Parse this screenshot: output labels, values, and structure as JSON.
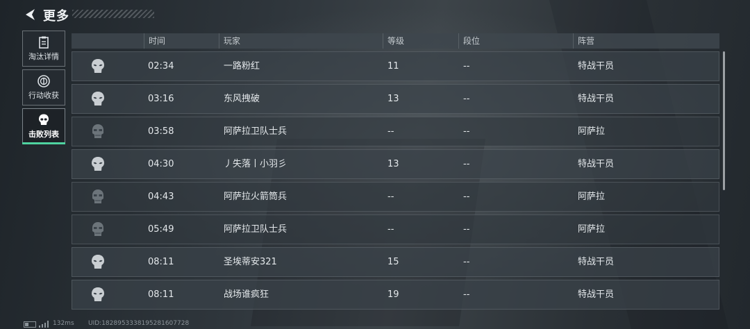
{
  "header": {
    "title": "更多"
  },
  "tabs": [
    {
      "label": "淘汰详情",
      "icon": "clipboard-icon",
      "active": false
    },
    {
      "label": "行动收获",
      "icon": "coin-icon",
      "active": false
    },
    {
      "label": "击败列表",
      "icon": "skull-icon",
      "active": true
    }
  ],
  "table": {
    "columns": {
      "time": "时间",
      "player": "玩家",
      "level": "等级",
      "rank": "段位",
      "faction": "阵营"
    },
    "rows": [
      {
        "time": "02:34",
        "player": "一路粉红",
        "level": "11",
        "rank": "--",
        "faction": "特战干员",
        "type": "operator"
      },
      {
        "time": "03:16",
        "player": "东风拽破",
        "level": "13",
        "rank": "--",
        "faction": "特战干员",
        "type": "operator"
      },
      {
        "time": "03:58",
        "player": "阿萨拉卫队士兵",
        "level": "--",
        "rank": "--",
        "faction": "阿萨拉",
        "type": "ai"
      },
      {
        "time": "04:30",
        "player": "丿失落丨小羽彡",
        "level": "13",
        "rank": "--",
        "faction": "特战干员",
        "type": "operator"
      },
      {
        "time": "04:43",
        "player": "阿萨拉火箭筒兵",
        "level": "--",
        "rank": "--",
        "faction": "阿萨拉",
        "type": "ai"
      },
      {
        "time": "05:49",
        "player": "阿萨拉卫队士兵",
        "level": "--",
        "rank": "--",
        "faction": "阿萨拉",
        "type": "ai"
      },
      {
        "time": "08:11",
        "player": "圣埃蒂安321",
        "level": "15",
        "rank": "--",
        "faction": "特战干员",
        "type": "operator"
      },
      {
        "time": "08:11",
        "player": "战场谁疯狂",
        "level": "19",
        "rank": "--",
        "faction": "特战干员",
        "type": "operator"
      }
    ]
  },
  "footer": {
    "ping": "132ms",
    "uid": "UID:1828953338195281607728"
  },
  "colors": {
    "accent": "#4fd3a0"
  }
}
